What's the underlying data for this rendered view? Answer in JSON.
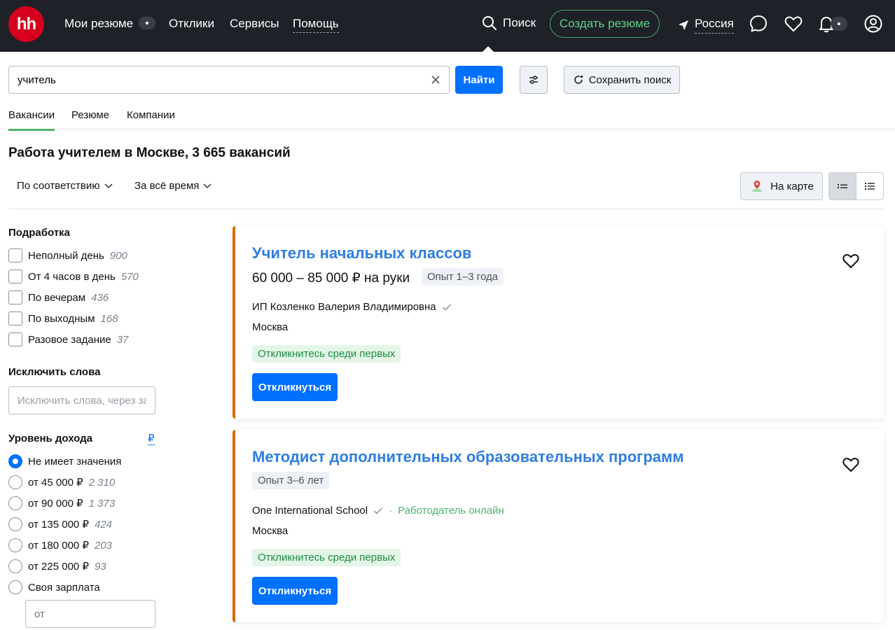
{
  "header": {
    "logo": "hh",
    "nav": [
      {
        "label": "Мои резюме"
      },
      {
        "label": "Отклики"
      },
      {
        "label": "Сервисы"
      },
      {
        "label": "Помощь"
      }
    ],
    "search_label": "Поиск",
    "create_resume": "Создать резюме",
    "region": "Россия"
  },
  "search": {
    "query": "учитель",
    "find_label": "Найти",
    "save_search_label": "Сохранить поиск"
  },
  "tabs": [
    "Вакансии",
    "Резюме",
    "Компании"
  ],
  "results": {
    "title": "Работа учителем в Москве, 3 665 вакансий",
    "sort_label": "По соответствию",
    "period_label": "За всё время",
    "map_label": "На карте"
  },
  "sidebar": {
    "part_time": {
      "heading": "Подработка",
      "options": [
        {
          "label": "Неполный день",
          "count": "900"
        },
        {
          "label": "От 4 часов в день",
          "count": "570"
        },
        {
          "label": "По вечерам",
          "count": "436"
        },
        {
          "label": "По выходным",
          "count": "168"
        },
        {
          "label": "Разовое задание",
          "count": "37"
        }
      ]
    },
    "exclude": {
      "heading": "Исключить слова",
      "placeholder": "Исключить слова, через запятую"
    },
    "income": {
      "heading": "Уровень дохода",
      "currency": "₽",
      "options": [
        {
          "label": "Не имеет значения",
          "count": ""
        },
        {
          "label": "от 45 000 ₽",
          "count": "2 310"
        },
        {
          "label": "от 90 000 ₽",
          "count": "1 373"
        },
        {
          "label": "от 135 000 ₽",
          "count": "424"
        },
        {
          "label": "от 180 000 ₽",
          "count": "203"
        },
        {
          "label": "от 225 000 ₽",
          "count": "93"
        },
        {
          "label": "Своя зарплата",
          "count": ""
        }
      ],
      "selected_index": 0,
      "custom_placeholder": "от"
    }
  },
  "vacancies": [
    {
      "title": "Учитель начальных классов",
      "salary": "60 000 – 85 000 ₽ на руки",
      "experience": "Опыт 1–3 года",
      "company": "ИП Козленко Валерия Владимировна",
      "online": "",
      "city": "Москва",
      "badge": "Откликнитесь среди первых",
      "apply": "Откликнуться"
    },
    {
      "title": "Методист дополнительных образовательных программ",
      "salary": "",
      "experience": "Опыт 3–6 лет",
      "company": "One International School",
      "online": "Работодатель онлайн",
      "city": "Москва",
      "badge": "Откликнитесь среди первых",
      "apply": "Откликнуться"
    }
  ],
  "colors": {
    "header_bg": "#1e2128",
    "logo_red": "#d6001c",
    "primary_blue": "#0070ff",
    "title_blue": "#2f7de0",
    "green": "#4ab56e",
    "card_accent": "#d46c0a"
  }
}
